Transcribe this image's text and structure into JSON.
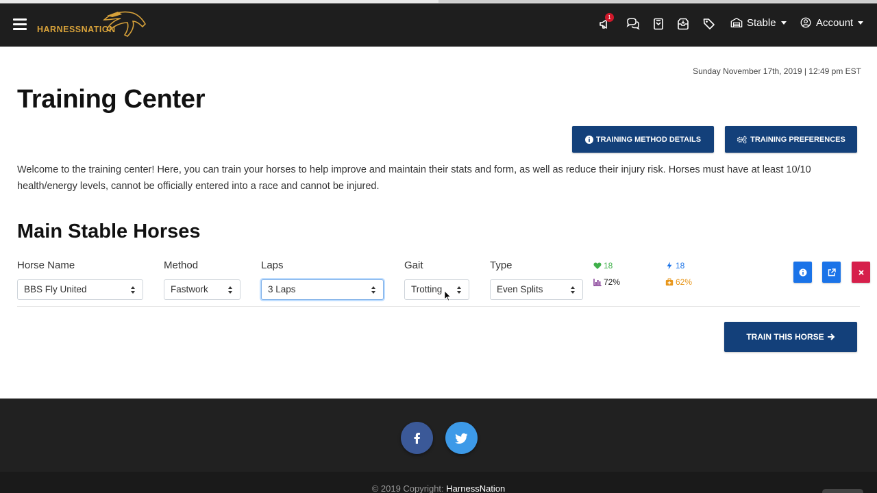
{
  "nav": {
    "logo_text": "HARNESSNATION",
    "notification_count": "1",
    "stable_label": "Stable",
    "account_label": "Account"
  },
  "page": {
    "datetime": "Sunday November 17th, 2019 | 12:49 pm EST",
    "title": "Training Center",
    "method_details_label": "TRAINING METHOD DETAILS",
    "preferences_label": "TRAINING PREFERENCES",
    "intro": "Welcome to the training center! Here, you can train your horses to help improve and maintain their stats and form, as well as reduce their injury risk. Horses must have at least 10/10 health/energy levels, cannot be officially entered into a race and cannot be injured.",
    "section_title": "Main Stable Horses"
  },
  "training_form": {
    "labels": {
      "horse_name": "Horse Name",
      "method": "Method",
      "laps": "Laps",
      "gait": "Gait",
      "type": "Type"
    },
    "values": {
      "horse_name": "BBS Fly United",
      "method": "Fastwork",
      "laps": "3 Laps",
      "gait": "Trotting",
      "type": "Even Splits"
    },
    "stats": {
      "health": "18",
      "energy": "18",
      "form": "72%",
      "injury_risk": "62%"
    },
    "train_label": "TRAIN THIS HORSE"
  },
  "footer": {
    "copyright_prefix": "© 2019 Copyright:",
    "copyright_link": "HarnessNation"
  },
  "colors": {
    "brand_gold": "#d8a23a",
    "navy": "#13407a",
    "health_green": "#3fb04a",
    "energy_blue": "#1a73e8",
    "form_purple": "#7b2d8e",
    "injury_orange": "#e8961a",
    "danger_red": "#d61f4b"
  }
}
